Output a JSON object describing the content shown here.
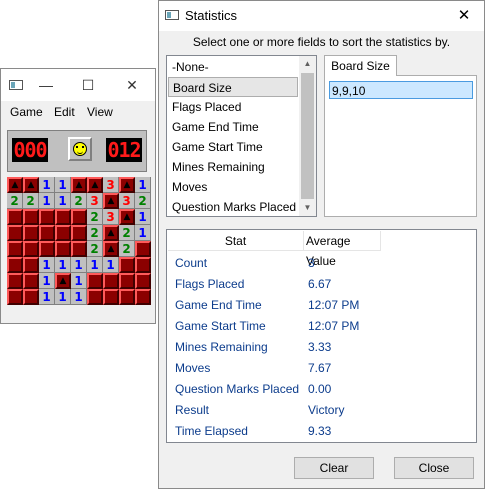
{
  "minesweeper": {
    "menu": [
      "Game",
      "Edit",
      "View"
    ],
    "mine_counter": "000",
    "timer": "012",
    "icons": {
      "app": "minesweeper-app-icon",
      "face": "smiley-face-icon",
      "flag": "flag-icon"
    },
    "board": [
      [
        "F",
        "F",
        "1",
        "1",
        "F",
        "F",
        "3",
        "F",
        "1"
      ],
      [
        "2",
        "2",
        "1",
        "1",
        "2",
        "3",
        "F",
        "3",
        "2"
      ],
      [
        "",
        "",
        "",
        "",
        "",
        "2",
        "3",
        "F",
        "1"
      ],
      [
        "",
        "",
        "",
        "",
        "",
        "2",
        "F",
        "2",
        "1"
      ],
      [
        "",
        "",
        "",
        "",
        "",
        "2",
        "F",
        "2",
        ""
      ],
      [
        "",
        "",
        "1",
        "1",
        "1",
        "1",
        "1",
        "",
        ""
      ],
      [
        "",
        "",
        "1",
        "F",
        "1",
        "",
        "",
        "",
        ""
      ],
      [
        "",
        "",
        "1",
        "1",
        "1",
        "",
        "",
        "",
        ""
      ]
    ],
    "closed_cells": [
      [
        0,
        0
      ],
      [
        0,
        1
      ],
      [
        0,
        4
      ],
      [
        0,
        5
      ],
      [
        0,
        7
      ],
      [
        1,
        6
      ],
      [
        2,
        0
      ],
      [
        2,
        1
      ],
      [
        2,
        2
      ],
      [
        2,
        3
      ],
      [
        2,
        4
      ],
      [
        2,
        7
      ],
      [
        3,
        0
      ],
      [
        3,
        1
      ],
      [
        3,
        2
      ],
      [
        3,
        3
      ],
      [
        3,
        4
      ],
      [
        3,
        6
      ],
      [
        4,
        0
      ],
      [
        4,
        1
      ],
      [
        4,
        2
      ],
      [
        4,
        3
      ],
      [
        4,
        4
      ],
      [
        4,
        6
      ],
      [
        4,
        8
      ],
      [
        5,
        0
      ],
      [
        5,
        1
      ],
      [
        5,
        7
      ],
      [
        5,
        8
      ],
      [
        6,
        0
      ],
      [
        6,
        1
      ],
      [
        6,
        3
      ],
      [
        6,
        5
      ],
      [
        6,
        6
      ],
      [
        6,
        7
      ],
      [
        6,
        8
      ],
      [
        7,
        0
      ],
      [
        7,
        1
      ],
      [
        7,
        5
      ],
      [
        7,
        6
      ],
      [
        7,
        7
      ],
      [
        7,
        8
      ]
    ]
  },
  "stats": {
    "title": "Statistics",
    "instruction": "Select one or more fields to sort the statistics by.",
    "fields": [
      "-None-",
      "Board Size",
      "Flags Placed",
      "Game End Time",
      "Game Start Time",
      "Mines Remaining",
      "Moves",
      "Question Marks Placed"
    ],
    "selected_field": "Board Size",
    "sort_tab": "Board Size",
    "sort_value": "9,9,10",
    "table_headers": {
      "stat": "Stat",
      "value": "Average Value"
    },
    "rows": [
      {
        "stat": "Count",
        "value": "3"
      },
      {
        "stat": "Flags Placed",
        "value": "6.67"
      },
      {
        "stat": "Game End Time",
        "value": "12:07 PM"
      },
      {
        "stat": "Game Start Time",
        "value": "12:07 PM"
      },
      {
        "stat": "Mines Remaining",
        "value": "3.33"
      },
      {
        "stat": "Moves",
        "value": "7.67"
      },
      {
        "stat": "Question Marks Placed",
        "value": "0.00"
      },
      {
        "stat": "Result",
        "value": "Victory"
      },
      {
        "stat": "Time Elapsed",
        "value": "9.33"
      }
    ],
    "clear_label": "Clear",
    "close_label": "Close"
  }
}
